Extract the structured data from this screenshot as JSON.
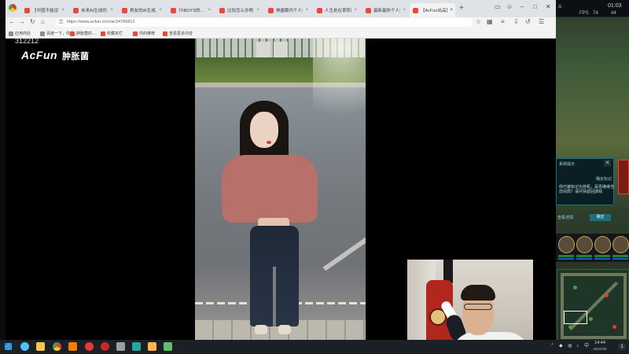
{
  "browser": {
    "tabs": [
      {
        "label": "【中国不能没有】你被…",
        "active": false
      },
      {
        "label": "未来AI生成的…",
        "active": false
      },
      {
        "label": "男友的AI生成…",
        "active": false
      },
      {
        "label": "TFBOYS的…",
        "active": false
      },
      {
        "label": "比较怎么办啊…",
        "active": false
      },
      {
        "label": "揭露跟内个人生…",
        "active": false
      },
      {
        "label": "人生处在某阶段…",
        "active": false
      },
      {
        "label": "最新最热个人生…",
        "active": false
      },
      {
        "label": "【AcFun出品】A…",
        "active": true
      }
    ],
    "new_tab": "+",
    "url": "https://www.acfun.cn/v/ac34789812",
    "bookmarks": [
      "应用商店",
      "百度一下，你就…",
      "肿胀菌的…",
      "收藏夹栏",
      "你的推荐",
      "查看更多内容"
    ]
  },
  "video": {
    "id_overlay": "312212",
    "logo_main": "AcFun",
    "logo_sub": "肿胀菌"
  },
  "game": {
    "top_time": "01:03",
    "fps_label": "FPS",
    "fps_value": "74",
    "ping": "44",
    "quest_title": "系统提示",
    "quest_sub": "确定标记",
    "quest_body": "你已被标记为挂机，是否继续当前对局？请尽快返回游戏",
    "quest_link": "查看详情",
    "quest_ok": "确定",
    "quest_close": "✕"
  },
  "taskbar": {
    "time": "14:44",
    "date": "2022/4/5",
    "notification": "1"
  },
  "colors": {
    "accent_tab": "#e64a3b",
    "taskbar": "#1b1f26",
    "quest_border": "#1f6f7a"
  }
}
